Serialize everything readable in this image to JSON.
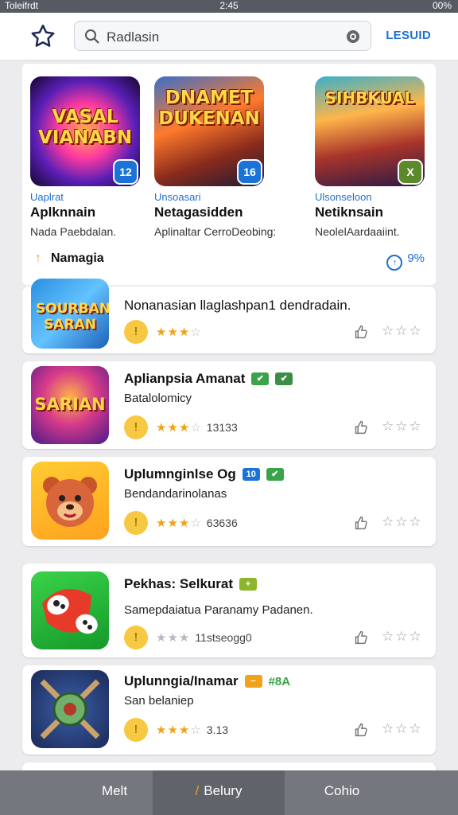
{
  "status_bar": {
    "left": "Toleifrdt",
    "time": "2:45",
    "right": "00%"
  },
  "header": {
    "search_placeholder": "Radlasin",
    "link_label": "LESUID"
  },
  "featured": {
    "items": [
      {
        "art_text": "VASAL VIANABN",
        "indicator": "12",
        "indicator_color": "#1b73d8",
        "subtitle": "Uaplrat",
        "title": "Aplknnain",
        "desc": "Nada Paebdalan."
      },
      {
        "art_text": "DNAMET DUKENAN",
        "indicator": "16",
        "indicator_color": "#1b73d8",
        "subtitle": "Unsoasari",
        "title": "Netagasidden",
        "desc": "Aplinaltar CerroDeobing:"
      },
      {
        "art_text": "SIHBKUAL",
        "indicator": "X",
        "indicator_color": "#5c8a2a",
        "subtitle": "Ulsonseloon",
        "title": "Netiknsain",
        "desc": "NeolelAardaaiint."
      }
    ],
    "section_label": "Namagia",
    "section_right": "9%"
  },
  "apps": [
    {
      "name": "Nonanasian llaglashpan1 dendradain.",
      "desc": "",
      "tags": [],
      "stars_on": 3,
      "stars_off": 1,
      "count": "",
      "badge": "!"
    },
    {
      "name": "Aplianpsia Amanat",
      "desc": "Batalolomicy",
      "tags": [
        {
          "label": "",
          "color": "#3aa44a"
        },
        {
          "label": "",
          "color": "#3b8e47"
        }
      ],
      "stars_on": 3,
      "stars_off": 1,
      "count": "13133",
      "badge": "!"
    },
    {
      "name": "Uplumnginlse Og",
      "desc": "Bendandarinolanas",
      "tags": [
        {
          "label": "10",
          "color": "#1b73d8"
        },
        {
          "label": "",
          "color": "#3aa44a"
        }
      ],
      "stars_on": 3,
      "stars_off": 1,
      "count": "63636",
      "badge": "!"
    },
    {
      "name": "Pekhas: Selkurat",
      "desc": "Samepdaiatua Paranamy Padanen.",
      "tags": [
        {
          "label": "+",
          "color": "#8bb52a"
        }
      ],
      "stars_on": 0,
      "stars_off": 3,
      "count": "11stseogg0",
      "badge": "!"
    },
    {
      "name": "Uplunngia/Inamar",
      "desc": "San belaniep",
      "tags": [
        {
          "label": "",
          "color": "#f0a218"
        },
        {
          "label": "#8A",
          "color": "#3aa44a"
        }
      ],
      "stars_on": 3,
      "stars_off": 1,
      "count": "3.13",
      "badge": "!"
    }
  ],
  "bottom_nav": {
    "tabs": [
      "Melt",
      "Belury",
      "Cohio"
    ]
  }
}
